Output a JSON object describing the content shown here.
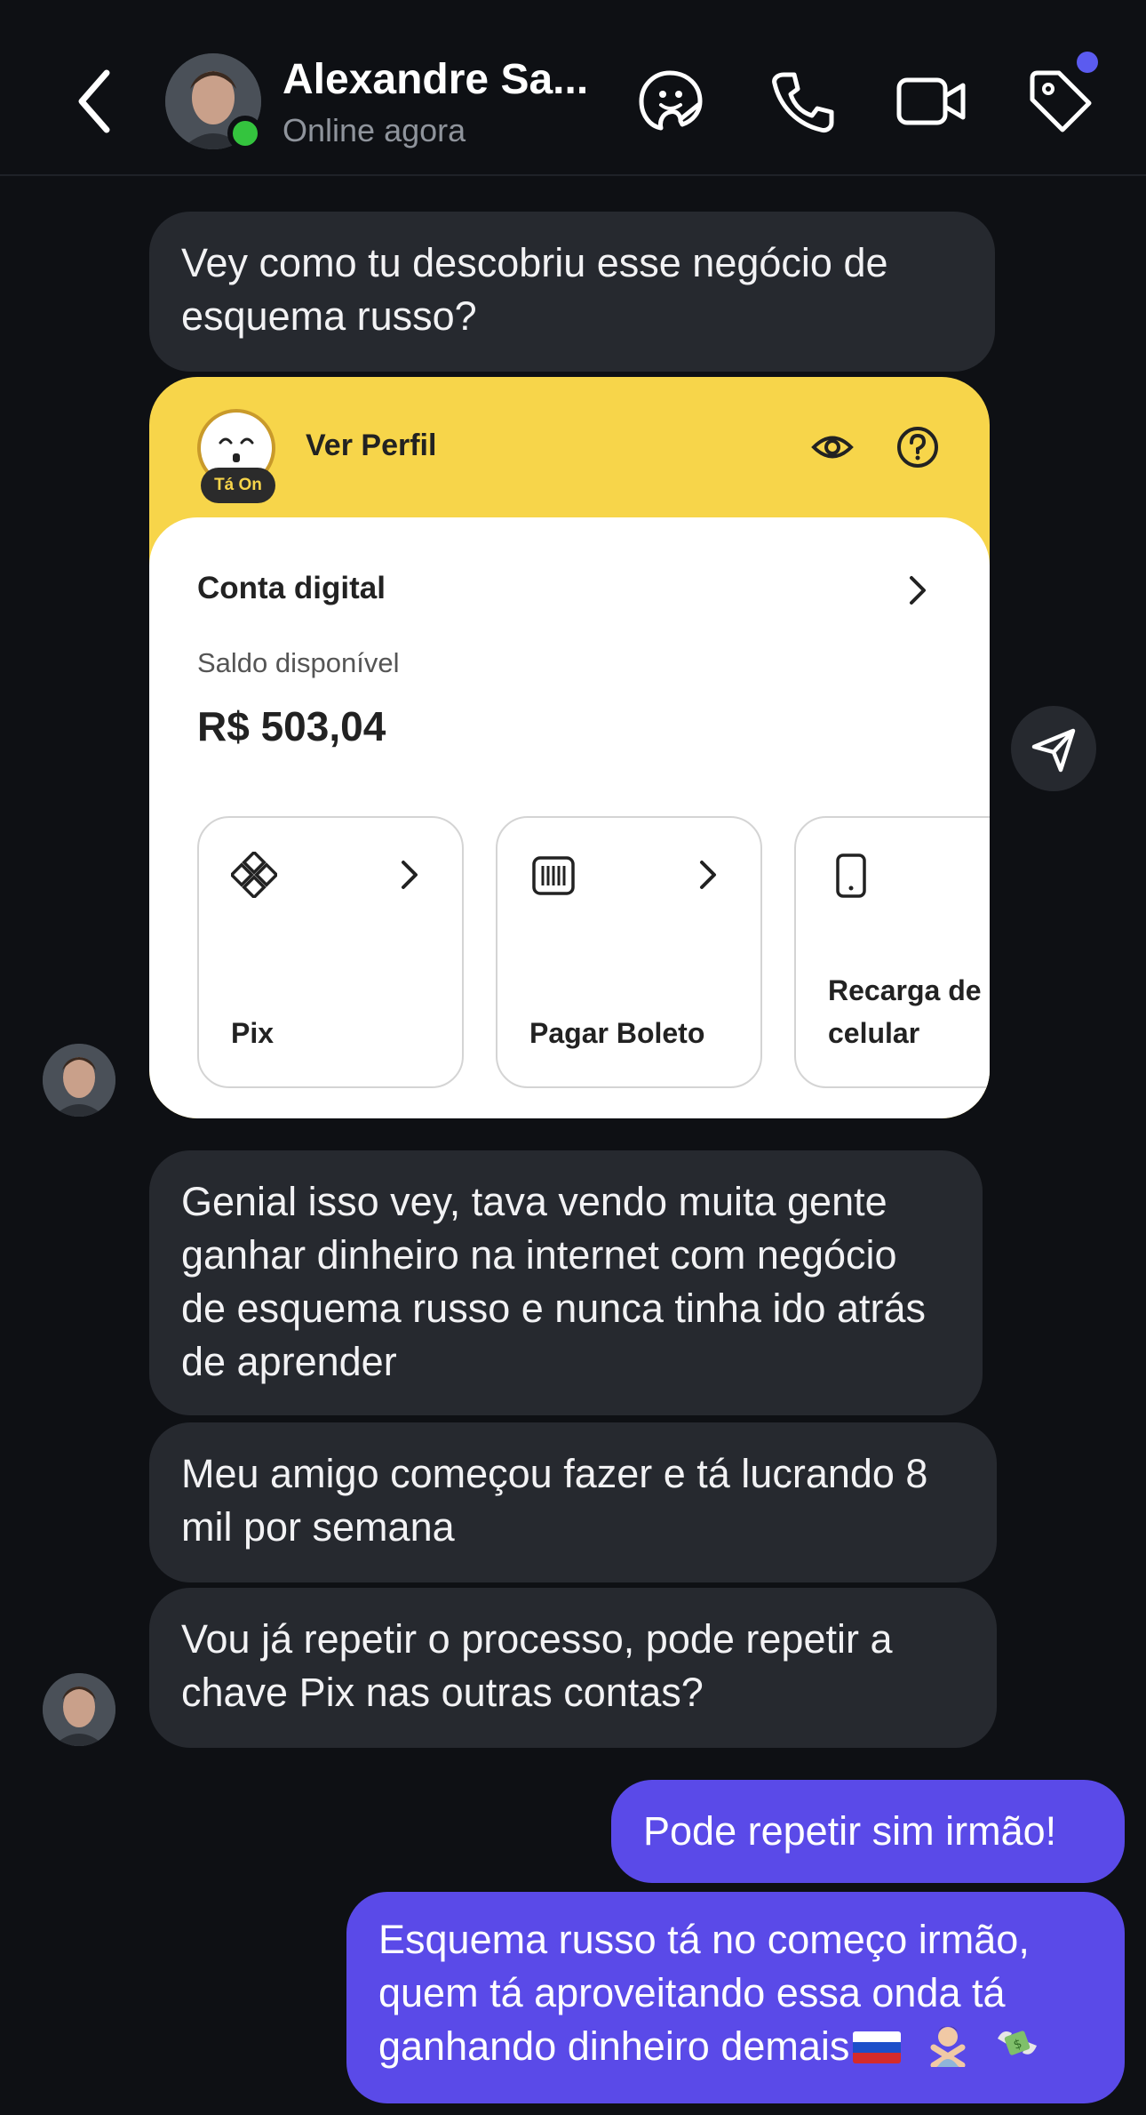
{
  "header": {
    "contact_name": "Alexandre Sa...",
    "status": "Online agora",
    "icons": [
      "back-icon",
      "sticker-icon",
      "phone-icon",
      "video-icon",
      "tag-icon"
    ]
  },
  "messages": [
    {
      "direction": "in",
      "text": "Vey como tu descobriu esse negócio de esquema russo?"
    },
    {
      "direction": "in",
      "text": "Genial isso vey, tava vendo muita gente ganhar dinheiro na internet com negócio de esquema russo e nunca tinha ido atrás de aprender"
    },
    {
      "direction": "in",
      "text": "Meu amigo começou fazer e tá lucrando 8 mil por semana"
    },
    {
      "direction": "in",
      "text": "Vou já repetir o processo, pode repetir a chave Pix nas outras contas?"
    },
    {
      "direction": "out",
      "text": "Pode repetir sim irmão!"
    },
    {
      "direction": "out",
      "text": "Esquema russo tá no começo irmão, quem tá aproveitando essa onda tá ganhando dinheiro demais",
      "emoji": [
        "russia-flag",
        "person-gesturing-no",
        "money-with-wings"
      ]
    }
  ],
  "card": {
    "avatar_badge": "Tá On",
    "ver_perfil": "Ver Perfil",
    "conta_title": "Conta digital",
    "saldo_label": "Saldo disponível",
    "saldo_value": "R$ 503,04",
    "tiles": [
      {
        "label": "Pix",
        "icon": "pix-icon"
      },
      {
        "label": "Pagar Boleto",
        "icon": "barcode-icon"
      },
      {
        "label": "Recarga de celular",
        "icon": "mobile-phone-icon"
      }
    ]
  },
  "colors": {
    "background": "#0e1014",
    "incoming_bubble": "#26292f",
    "outgoing_bubble": "#5a4ae8",
    "card_yellow": "#f7d54a",
    "online_green": "#34c43e"
  }
}
